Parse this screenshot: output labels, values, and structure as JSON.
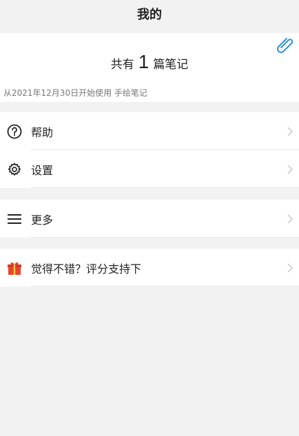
{
  "header": {
    "title": "我的"
  },
  "summary": {
    "count_prefix": "共有",
    "count": "1",
    "count_suffix": "篇笔记",
    "since_text": "从2021年12月30日开始使用 手绘笔记"
  },
  "menu": {
    "help": "帮助",
    "settings": "设置",
    "more": "更多",
    "rate": "觉得不错？评分支持下"
  },
  "colors": {
    "accent_clip": "#2a8fd6",
    "gift_red": "#e8452c"
  }
}
